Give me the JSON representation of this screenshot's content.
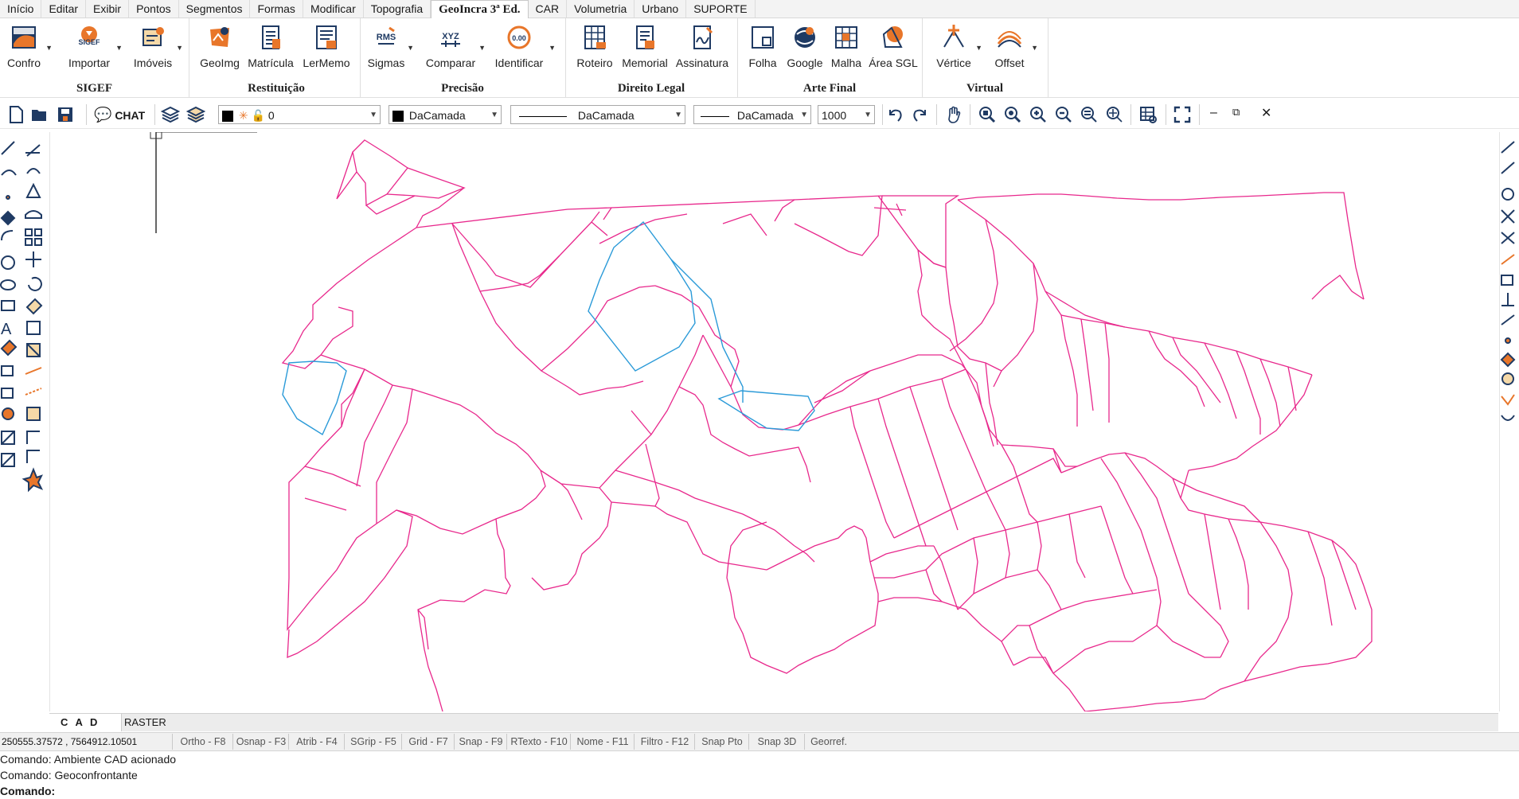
{
  "menu": {
    "tabs": [
      "Início",
      "Editar",
      "Exibir",
      "Pontos",
      "Segmentos",
      "Formas",
      "Modificar",
      "Topografia",
      "GeoIncra 3ª Ed.",
      "CAR",
      "Volumetria",
      "Urbano",
      "SUPORTE"
    ],
    "active": "GeoIncra 3ª Ed."
  },
  "ribbon": {
    "groups": [
      {
        "title": "SIGEF",
        "buttons": [
          "Confro",
          "Importar",
          "Imóveis"
        ]
      },
      {
        "title": "Restituição",
        "buttons": [
          "GeoImg",
          "Matrícula",
          "LerMemo"
        ]
      },
      {
        "title": "Precisão",
        "buttons": [
          "Sigmas",
          "Comparar",
          "Identificar"
        ]
      },
      {
        "title": "Direito Legal",
        "buttons": [
          "Roteiro",
          "Memorial",
          "Assinatura"
        ]
      },
      {
        "title": "Arte Final",
        "buttons": [
          "Folha",
          "Google",
          "Malha",
          "Área SGL"
        ]
      },
      {
        "title": "Virtual",
        "buttons": [
          "Vértice",
          "Offset"
        ]
      }
    ],
    "icon_texts": {
      "sigef": "SIGEF",
      "rms": "RMS",
      "xyz": "XYZ",
      "ident": "0.00"
    }
  },
  "toolbar": {
    "chat_label": "CHAT",
    "layer_value": "0",
    "color_value": "DaCamada",
    "linetype_value": "DaCamada",
    "lineweight_value": "DaCamada",
    "scale_value": "1000"
  },
  "bottom_tabs": [
    "C A D",
    "RASTER"
  ],
  "status": {
    "coords": "250555.37572 , 7564912.10501",
    "toggles": [
      "Ortho - F8",
      "Osnap - F3",
      "Atrib - F4",
      "SGrip - F5",
      "Grid - F7",
      "Snap - F9",
      "RTexto - F10",
      "Nome - F11",
      "Filtro - F12",
      "Snap Pto",
      "Snap 3D",
      "Georref."
    ]
  },
  "command": {
    "lines": [
      "Comando: Ambiente CAD acionado",
      "Comando: Geoconfrontante"
    ],
    "prompt": "Comando:"
  },
  "colors": {
    "parcel_stroke": "#e8288c",
    "highlight_stroke": "#2a9ad8",
    "accent_orange": "#e8762a",
    "icon_navy": "#1f3a63"
  }
}
